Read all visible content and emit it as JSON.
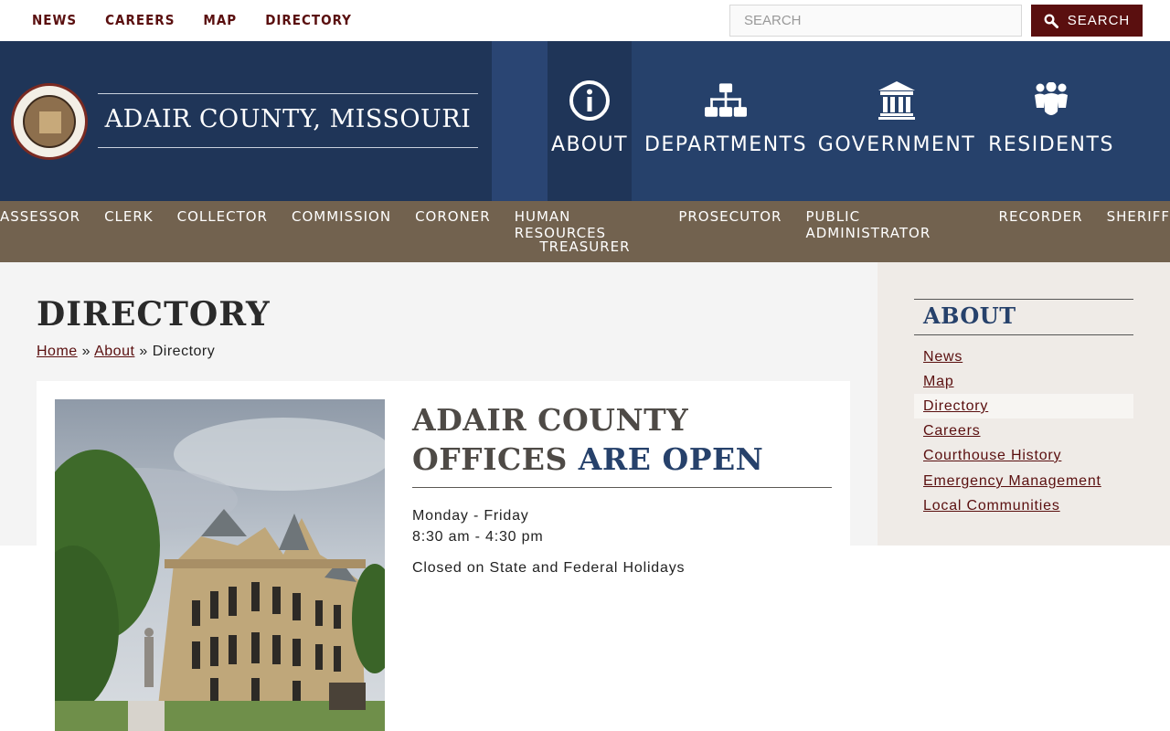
{
  "top_links": [
    "NEWS",
    "CAREERS",
    "MAP",
    "DIRECTORY"
  ],
  "search": {
    "placeholder": "SEARCH",
    "button_label": "SEARCH"
  },
  "site_title": "ADAIR COUNTY, MISSOURI",
  "main_nav": [
    {
      "label": "ABOUT",
      "icon": "info-circle-icon",
      "active": true
    },
    {
      "label": "DEPARTMENTS",
      "icon": "sitemap-icon",
      "active": false
    },
    {
      "label": "GOVERNMENT",
      "icon": "landmark-icon",
      "active": false
    },
    {
      "label": "RESIDENTS",
      "icon": "people-icon",
      "active": false
    }
  ],
  "departments": [
    "ASSESSOR",
    "CLERK",
    "COLLECTOR",
    "COMMISSION",
    "CORONER",
    "HUMAN RESOURCES",
    "PROSECUTOR",
    "PUBLIC ADMINISTRATOR",
    "RECORDER",
    "SHERIFF",
    "TREASURER"
  ],
  "page": {
    "title": "DIRECTORY",
    "breadcrumb": {
      "home": "Home",
      "sep": "»",
      "about": "About",
      "current": "Directory"
    }
  },
  "notice": {
    "title_part1": "ADAIR COUNTY OFFICES ",
    "title_part2": "ARE OPEN",
    "days": "Monday - Friday",
    "hours": "8:30 am - 4:30 pm",
    "note": "Closed on State and Federal Holidays"
  },
  "sidebar": {
    "title": "ABOUT",
    "links": [
      {
        "label": "News",
        "active": false
      },
      {
        "label": "Map",
        "active": false
      },
      {
        "label": "Directory",
        "active": true
      },
      {
        "label": "Careers",
        "active": false
      },
      {
        "label": "Courthouse History",
        "active": false
      },
      {
        "label": "Emergency Management",
        "active": false
      },
      {
        "label": "Local Communities",
        "active": false
      }
    ]
  },
  "colors": {
    "maroon": "#5a0f0f",
    "navy": "#26416b",
    "navy_dark": "#1f3558",
    "brown": "#72624f"
  }
}
